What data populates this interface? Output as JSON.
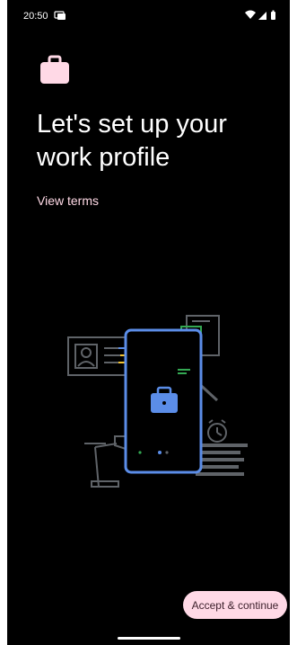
{
  "status_bar": {
    "time": "20:50",
    "notification_icon": "messages-icon",
    "right_icons": [
      "wifi-icon",
      "cellular-signal-icon",
      "battery-icon"
    ]
  },
  "header": {
    "icon": "briefcase-icon",
    "title": "Let's set up your work profile"
  },
  "links": {
    "view_terms": "View terms"
  },
  "illustration": {
    "icon": "work-profile-illustration"
  },
  "actions": {
    "accept_label": "Accept & continue"
  },
  "colors": {
    "background": "#000000",
    "accent_pink": "#ffd9e6",
    "illustration_blue": "#5b8de8",
    "illustration_yellow": "#f4c430",
    "illustration_green": "#34a853",
    "illustration_gray": "#5f6368"
  }
}
